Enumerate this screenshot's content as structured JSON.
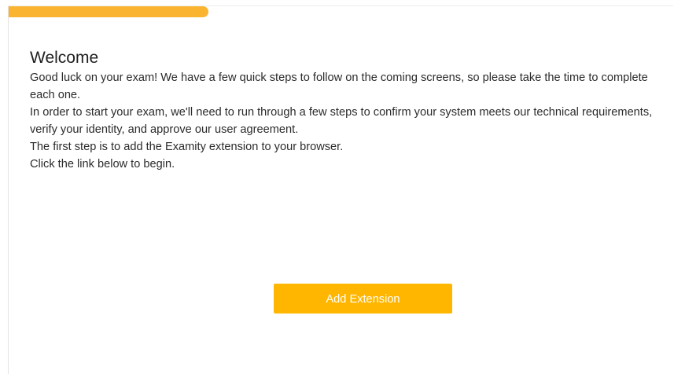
{
  "progress": {
    "fraction": 0.3,
    "color": "#fbb430"
  },
  "welcome": {
    "title": "Welcome",
    "paragraphs": [
      "Good luck on your exam! We have a few quick steps to follow on the coming screens, so please take the time to complete each one.",
      "In order to start your exam, we'll need to run through a few steps to confirm your system meets our technical requirements, verify your identity, and approve our user agreement.",
      "The first step is to add the Examity extension to your browser.",
      "Click the link below to begin."
    ],
    "button_label": "Add Extension",
    "button_color": "#ffb600"
  }
}
